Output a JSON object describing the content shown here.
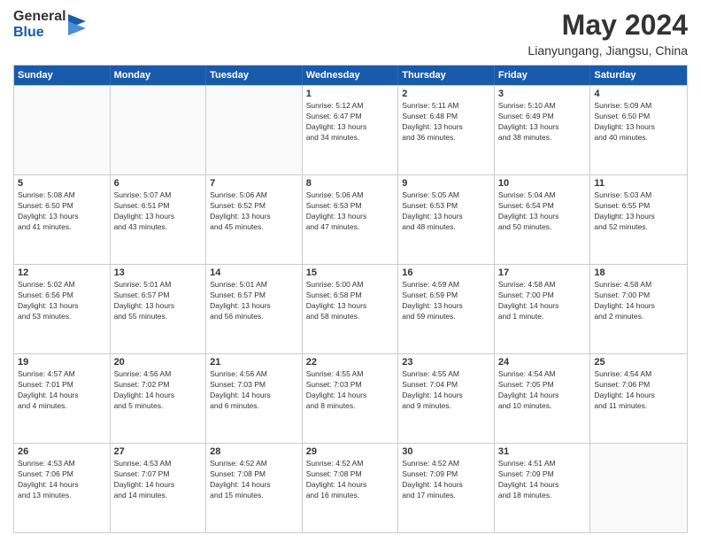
{
  "header": {
    "logo_general": "General",
    "logo_blue": "Blue",
    "month": "May 2024",
    "location": "Lianyungang, Jiangsu, China"
  },
  "days_of_week": [
    "Sunday",
    "Monday",
    "Tuesday",
    "Wednesday",
    "Thursday",
    "Friday",
    "Saturday"
  ],
  "weeks": [
    [
      {
        "day": "",
        "info": ""
      },
      {
        "day": "",
        "info": ""
      },
      {
        "day": "",
        "info": ""
      },
      {
        "day": "1",
        "info": "Sunrise: 5:12 AM\nSunset: 6:47 PM\nDaylight: 13 hours\nand 34 minutes."
      },
      {
        "day": "2",
        "info": "Sunrise: 5:11 AM\nSunset: 6:48 PM\nDaylight: 13 hours\nand 36 minutes."
      },
      {
        "day": "3",
        "info": "Sunrise: 5:10 AM\nSunset: 6:49 PM\nDaylight: 13 hours\nand 38 minutes."
      },
      {
        "day": "4",
        "info": "Sunrise: 5:09 AM\nSunset: 6:50 PM\nDaylight: 13 hours\nand 40 minutes."
      }
    ],
    [
      {
        "day": "5",
        "info": "Sunrise: 5:08 AM\nSunset: 6:50 PM\nDaylight: 13 hours\nand 41 minutes."
      },
      {
        "day": "6",
        "info": "Sunrise: 5:07 AM\nSunset: 6:51 PM\nDaylight: 13 hours\nand 43 minutes."
      },
      {
        "day": "7",
        "info": "Sunrise: 5:06 AM\nSunset: 6:52 PM\nDaylight: 13 hours\nand 45 minutes."
      },
      {
        "day": "8",
        "info": "Sunrise: 5:06 AM\nSunset: 6:53 PM\nDaylight: 13 hours\nand 47 minutes."
      },
      {
        "day": "9",
        "info": "Sunrise: 5:05 AM\nSunset: 6:53 PM\nDaylight: 13 hours\nand 48 minutes."
      },
      {
        "day": "10",
        "info": "Sunrise: 5:04 AM\nSunset: 6:54 PM\nDaylight: 13 hours\nand 50 minutes."
      },
      {
        "day": "11",
        "info": "Sunrise: 5:03 AM\nSunset: 6:55 PM\nDaylight: 13 hours\nand 52 minutes."
      }
    ],
    [
      {
        "day": "12",
        "info": "Sunrise: 5:02 AM\nSunset: 6:56 PM\nDaylight: 13 hours\nand 53 minutes."
      },
      {
        "day": "13",
        "info": "Sunrise: 5:01 AM\nSunset: 6:57 PM\nDaylight: 13 hours\nand 55 minutes."
      },
      {
        "day": "14",
        "info": "Sunrise: 5:01 AM\nSunset: 6:57 PM\nDaylight: 13 hours\nand 56 minutes."
      },
      {
        "day": "15",
        "info": "Sunrise: 5:00 AM\nSunset: 6:58 PM\nDaylight: 13 hours\nand 58 minutes."
      },
      {
        "day": "16",
        "info": "Sunrise: 4:59 AM\nSunset: 6:59 PM\nDaylight: 13 hours\nand 59 minutes."
      },
      {
        "day": "17",
        "info": "Sunrise: 4:58 AM\nSunset: 7:00 PM\nDaylight: 14 hours\nand 1 minute."
      },
      {
        "day": "18",
        "info": "Sunrise: 4:58 AM\nSunset: 7:00 PM\nDaylight: 14 hours\nand 2 minutes."
      }
    ],
    [
      {
        "day": "19",
        "info": "Sunrise: 4:57 AM\nSunset: 7:01 PM\nDaylight: 14 hours\nand 4 minutes."
      },
      {
        "day": "20",
        "info": "Sunrise: 4:56 AM\nSunset: 7:02 PM\nDaylight: 14 hours\nand 5 minutes."
      },
      {
        "day": "21",
        "info": "Sunrise: 4:56 AM\nSunset: 7:03 PM\nDaylight: 14 hours\nand 6 minutes."
      },
      {
        "day": "22",
        "info": "Sunrise: 4:55 AM\nSunset: 7:03 PM\nDaylight: 14 hours\nand 8 minutes."
      },
      {
        "day": "23",
        "info": "Sunrise: 4:55 AM\nSunset: 7:04 PM\nDaylight: 14 hours\nand 9 minutes."
      },
      {
        "day": "24",
        "info": "Sunrise: 4:54 AM\nSunset: 7:05 PM\nDaylight: 14 hours\nand 10 minutes."
      },
      {
        "day": "25",
        "info": "Sunrise: 4:54 AM\nSunset: 7:06 PM\nDaylight: 14 hours\nand 11 minutes."
      }
    ],
    [
      {
        "day": "26",
        "info": "Sunrise: 4:53 AM\nSunset: 7:06 PM\nDaylight: 14 hours\nand 13 minutes."
      },
      {
        "day": "27",
        "info": "Sunrise: 4:53 AM\nSunset: 7:07 PM\nDaylight: 14 hours\nand 14 minutes."
      },
      {
        "day": "28",
        "info": "Sunrise: 4:52 AM\nSunset: 7:08 PM\nDaylight: 14 hours\nand 15 minutes."
      },
      {
        "day": "29",
        "info": "Sunrise: 4:52 AM\nSunset: 7:08 PM\nDaylight: 14 hours\nand 16 minutes."
      },
      {
        "day": "30",
        "info": "Sunrise: 4:52 AM\nSunset: 7:09 PM\nDaylight: 14 hours\nand 17 minutes."
      },
      {
        "day": "31",
        "info": "Sunrise: 4:51 AM\nSunset: 7:09 PM\nDaylight: 14 hours\nand 18 minutes."
      },
      {
        "day": "",
        "info": ""
      }
    ]
  ]
}
